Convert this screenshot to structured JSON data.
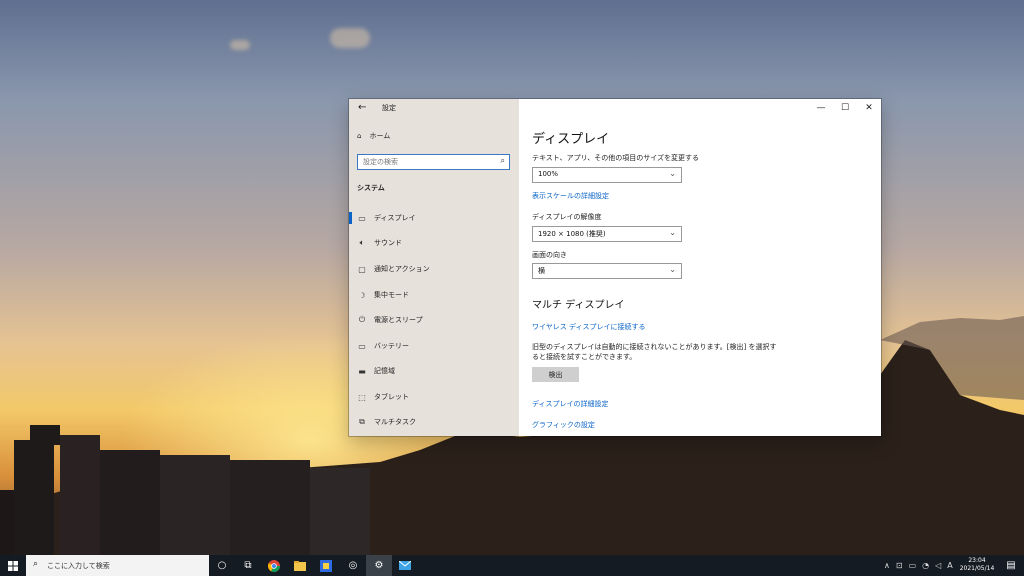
{
  "window": {
    "title": "設定",
    "back_glyph": "←",
    "controls": {
      "minimize": "—",
      "maximize": "☐",
      "close": "✕"
    }
  },
  "sidebar": {
    "home_label": "ホーム",
    "search_placeholder": "設定の検索",
    "section_title": "システム",
    "items": [
      {
        "label": "ディスプレイ",
        "icon": "monitor-icon",
        "glyph": "▭",
        "selected": true
      },
      {
        "label": "サウンド",
        "icon": "speaker-icon",
        "glyph": "🔈︎",
        "selected": false
      },
      {
        "label": "通知とアクション",
        "icon": "message-icon",
        "glyph": "▢",
        "selected": false
      },
      {
        "label": "集中モード",
        "icon": "moon-icon",
        "glyph": "☽",
        "selected": false
      },
      {
        "label": "電源とスリープ",
        "icon": "power-icon",
        "glyph": "⏻",
        "selected": false
      },
      {
        "label": "バッテリー",
        "icon": "battery-icon",
        "glyph": "▭",
        "selected": false
      },
      {
        "label": "記憶域",
        "icon": "storage-icon",
        "glyph": "▬",
        "selected": false
      },
      {
        "label": "タブレット",
        "icon": "tablet-icon",
        "glyph": "⬚",
        "selected": false
      },
      {
        "label": "マルチタスク",
        "icon": "multitask-icon",
        "glyph": "⧉",
        "selected": false
      }
    ]
  },
  "main": {
    "title": "ディスプレイ",
    "scale_label": "テキスト、アプリ、その他の項目のサイズを変更する",
    "scale_value": "100%",
    "scale_link": "表示スケールの詳細設定",
    "resolution_label": "ディスプレイの解像度",
    "resolution_value": "1920 × 1080 (推奨)",
    "orientation_label": "画面の向き",
    "orientation_value": "横",
    "multi_title": "マルチ ディスプレイ",
    "wireless_link": "ワイヤレス ディスプレイに接続する",
    "detect_text": "旧型のディスプレイは自動的に接続されないことがあります。[検出] を選択すると接続を試すことができます。",
    "detect_button": "検出",
    "advanced_link": "ディスプレイの詳細設定",
    "graphics_link": "グラフィックの設定"
  },
  "taskbar": {
    "search_placeholder": "ここに入力して検索",
    "clock_time": "23:04",
    "clock_date": "2021/05/14",
    "ime": "A"
  },
  "colors": {
    "accent": "#0a64c8",
    "taskbar": "#141b23",
    "sidebar": "#e7e1db"
  }
}
